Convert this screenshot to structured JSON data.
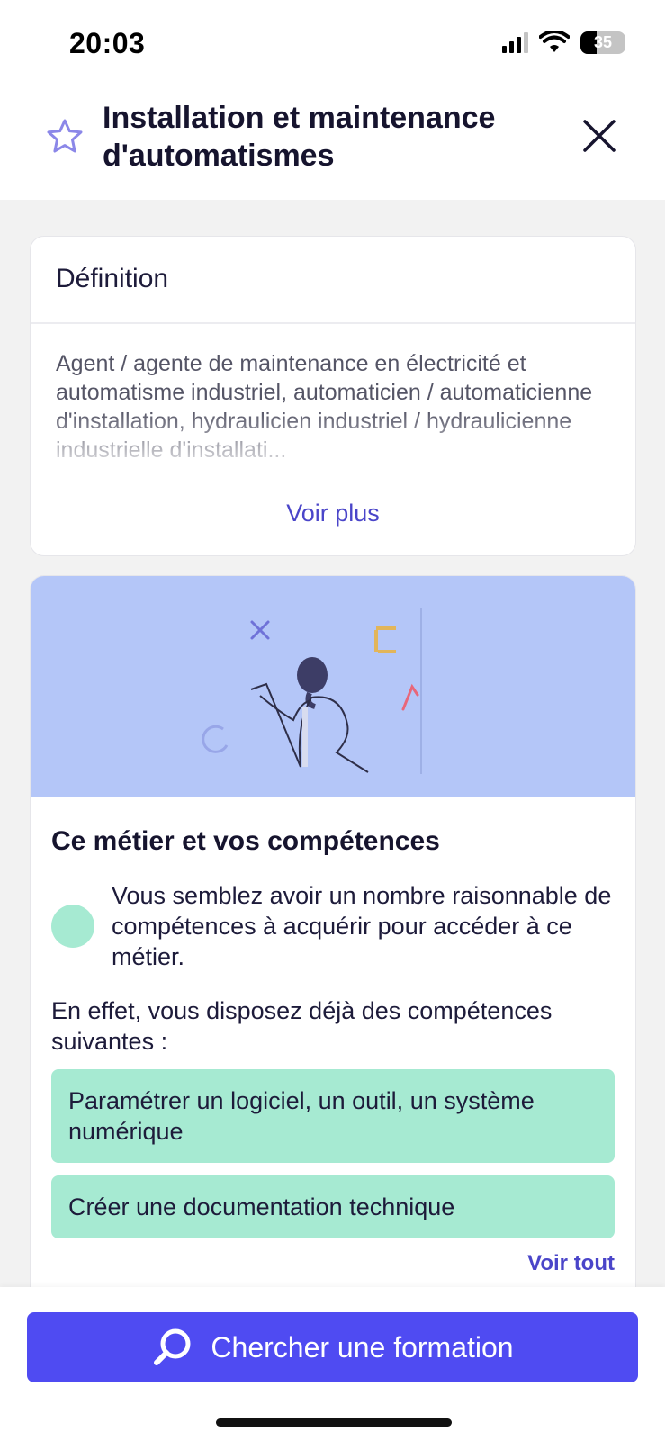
{
  "status_bar": {
    "time": "20:03",
    "battery": "35",
    "battery_level": 0.35
  },
  "header": {
    "title": "Installation et maintenance d'automatismes"
  },
  "definition": {
    "title": "Définition",
    "text": "Agent / agente de maintenance en électricité et automatisme industriel, automaticien / automaticienne d'installation, hydraulicien industriel / hydraulicienne industrielle d'installati...",
    "more_link": "Voir plus"
  },
  "skills": {
    "title": "Ce métier et vos compétences",
    "status_text": "Vous semblez avoir un nombre raisonnable de compétences à acquérir pour accéder à ce métier.",
    "intro": "En effet, vous disposez déjà des compétences suivantes :",
    "items": [
      "Paramétrer un logiciel, un outil, un système numérique",
      "Créer une documentation technique"
    ],
    "see_all": "Voir tout"
  },
  "cta": {
    "label": "Chercher une formation"
  },
  "colors": {
    "accent": "#4f4bf2",
    "link": "#4a45c9",
    "skill_green": "#a6ead2",
    "illustration_bg": "#b4c6f8"
  }
}
